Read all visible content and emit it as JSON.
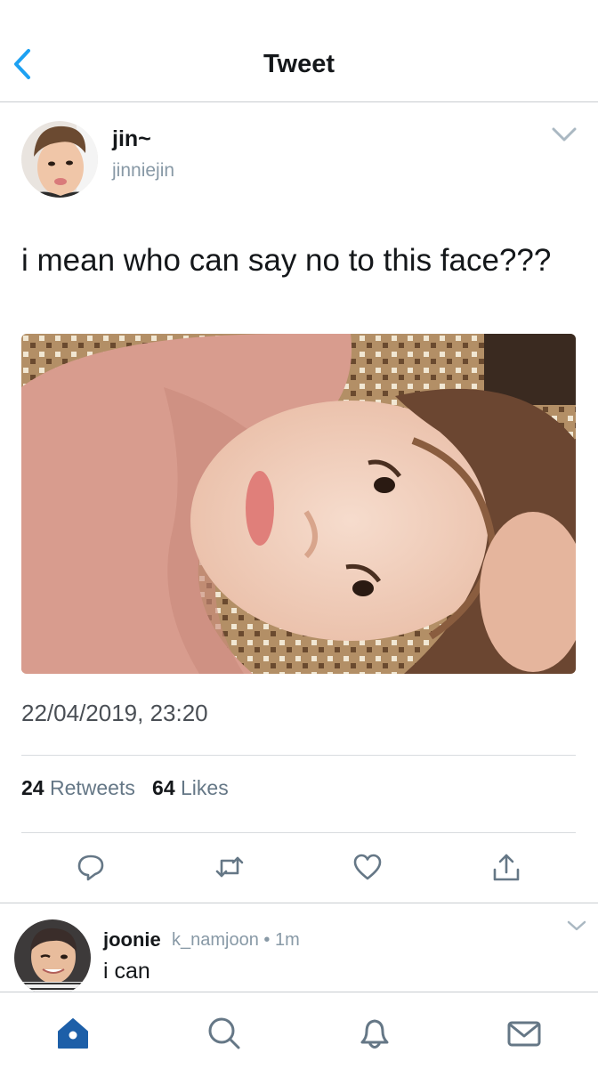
{
  "header": {
    "title": "Tweet",
    "back_icon": "chevron-left-icon"
  },
  "tweet": {
    "author_name": "jin~",
    "author_handle": "jinniejin",
    "text": "i mean who can say no to this face???",
    "timestamp": "22/04/2019, 23:20",
    "retweets_count": "24",
    "retweets_label": "Retweets",
    "likes_count": "64",
    "likes_label": "Likes",
    "actions": [
      "reply-icon",
      "retweet-icon",
      "like-icon",
      "share-icon"
    ]
  },
  "reply": {
    "author_name": "joonie",
    "author_handle": "k_namjoon",
    "time": "• 1m",
    "text": "i can"
  },
  "tabbar": {
    "items": [
      "home-icon",
      "search-icon",
      "notifications-icon",
      "messages-icon"
    ]
  },
  "colors": {
    "accent": "#1da1f2",
    "home_active": "#1d5fa8",
    "secondary_text": "#8899a6",
    "icon_gray": "#657786"
  }
}
